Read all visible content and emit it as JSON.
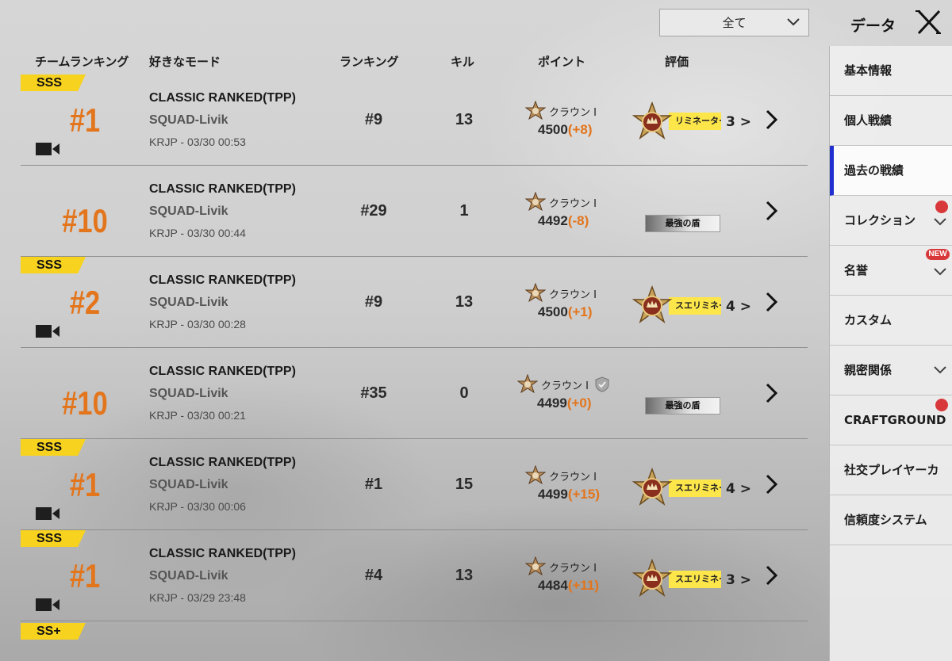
{
  "filter": {
    "selected": "全て"
  },
  "header": {
    "title": "データ"
  },
  "columns": {
    "team_ranking": "チームランキング",
    "fav_mode": "好きなモード",
    "ranking": "ランキング",
    "kills": "キル",
    "points": "ポイント",
    "rating": "評価"
  },
  "matches": [
    {
      "badge": "SSS",
      "place": "#1",
      "has_replay": true,
      "mode": "CLASSIC RANKED(TPP)",
      "sub": "SQUAD-Livik",
      "date": "KRJP - 03/30 00:53",
      "ranking": "#9",
      "kills": "13",
      "tier": "クラウン Ⅰ",
      "points": "4500",
      "delta": "(+8)",
      "honor": "リミネーター",
      "honor_count": "3 >"
    },
    {
      "badge": "",
      "place": "#10",
      "has_replay": false,
      "mode": "CLASSIC RANKED(TPP)",
      "sub": "SQUAD-Livik",
      "date": "KRJP - 03/30 00:44",
      "ranking": "#29",
      "kills": "1",
      "tier": "クラウン Ⅰ",
      "points": "4492",
      "delta": "(-8)",
      "honor": "最強の盾",
      "honor_count": ""
    },
    {
      "badge": "SSS",
      "place": "#2",
      "has_replay": true,
      "mode": "CLASSIC RANKED(TPP)",
      "sub": "SQUAD-Livik",
      "date": "KRJP - 03/30 00:28",
      "ranking": "#9",
      "kills": "13",
      "tier": "クラウン Ⅰ",
      "points": "4500",
      "delta": "(+1)",
      "honor": "スエリミネー",
      "honor_count": "4 >"
    },
    {
      "badge": "",
      "place": "#10",
      "has_replay": false,
      "mode": "CLASSIC RANKED(TPP)",
      "sub": "SQUAD-Livik",
      "date": "KRJP - 03/30 00:21",
      "ranking": "#35",
      "kills": "0",
      "tier": "クラウン Ⅰ",
      "points": "4499",
      "delta": "(+0)",
      "honor": "最強の盾",
      "honor_count": ""
    },
    {
      "badge": "SSS",
      "place": "#1",
      "has_replay": true,
      "mode": "CLASSIC RANKED(TPP)",
      "sub": "SQUAD-Livik",
      "date": "KRJP - 03/30 00:06",
      "ranking": "#1",
      "kills": "15",
      "tier": "クラウン Ⅰ",
      "points": "4499",
      "delta": "(+15)",
      "honor": "スエリミネー",
      "honor_count": "4 >"
    },
    {
      "badge": "SSS",
      "place": "#1",
      "has_replay": true,
      "mode": "CLASSIC RANKED(TPP)",
      "sub": "SQUAD-Livik",
      "date": "KRJP - 03/29 23:48",
      "ranking": "#4",
      "kills": "13",
      "tier": "クラウン Ⅰ",
      "points": "4484",
      "delta": "(+11)",
      "honor": "スエリミネー",
      "honor_count": "3 >"
    }
  ],
  "next_badge": "SS+",
  "sidebar": {
    "items": [
      {
        "label": "基本情報"
      },
      {
        "label": "個人戦績"
      },
      {
        "label": "過去の戦績"
      },
      {
        "label": "コレクション"
      },
      {
        "label": "名誉"
      },
      {
        "label": "カスタム"
      },
      {
        "label": "親密関係"
      },
      {
        "label": "CRAFTGROUND"
      },
      {
        "label": "社交プレイヤーカ"
      },
      {
        "label": "信頼度システム"
      }
    ],
    "new_label": "NEW"
  },
  "colors": {
    "accent": "#e3751c",
    "badge": "#f7d21f",
    "active": "#1f2fd0"
  }
}
